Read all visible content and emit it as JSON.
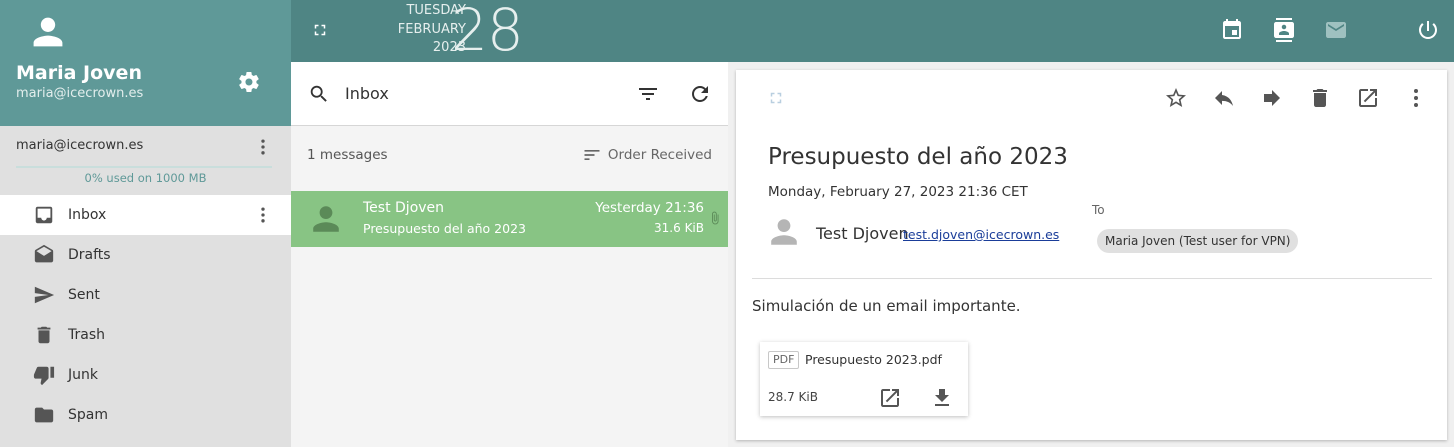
{
  "topbar": {
    "weekday": "TUESDAY",
    "month": "FEBRUARY",
    "year": "2023",
    "day": "28",
    "icons": [
      "calendar-icon",
      "contacts-icon",
      "mail-icon",
      "power-icon"
    ]
  },
  "account": {
    "name": "Maria Joven",
    "email": "maria@icecrown.es",
    "row_email": "maria@icecrown.es",
    "quota": "0% used on 1000 MB",
    "quota_fraction": 0
  },
  "folders": [
    {
      "label": "Inbox",
      "icon": "inbox-icon",
      "active": true
    },
    {
      "label": "Drafts",
      "icon": "drafts-icon",
      "active": false
    },
    {
      "label": "Sent",
      "icon": "sent-icon",
      "active": false
    },
    {
      "label": "Trash",
      "icon": "trash-icon",
      "active": false
    },
    {
      "label": "Junk",
      "icon": "junk-icon",
      "active": false
    },
    {
      "label": "Spam",
      "icon": "spam-icon",
      "active": false
    }
  ],
  "list": {
    "title": "Inbox",
    "count": "1 messages",
    "sort_label": "Order Received",
    "messages": [
      {
        "from": "Test Djoven",
        "subject": "Presupuesto del año 2023",
        "date": "Yesterday 21:36",
        "size": "31.6 KiB",
        "has_attachment": true
      }
    ]
  },
  "reader": {
    "subject": "Presupuesto del año 2023",
    "date": "Monday, February 27, 2023 21:36 CET",
    "sender_name": "Test Djoven",
    "sender_email": "test.djoven@icecrown.es",
    "to_label": "To",
    "to_recipient": "Maria Joven (Test user for VPN)",
    "body": "Simulación de un email importante.",
    "attachment": {
      "type": "PDF",
      "name": "Presupuesto 2023.pdf",
      "size": "28.7 KiB"
    }
  },
  "colors": {
    "topbar": "#4f8584",
    "account_header": "#5f9998",
    "selected_row": "#88c484",
    "sidebar": "#e0e0e0"
  }
}
